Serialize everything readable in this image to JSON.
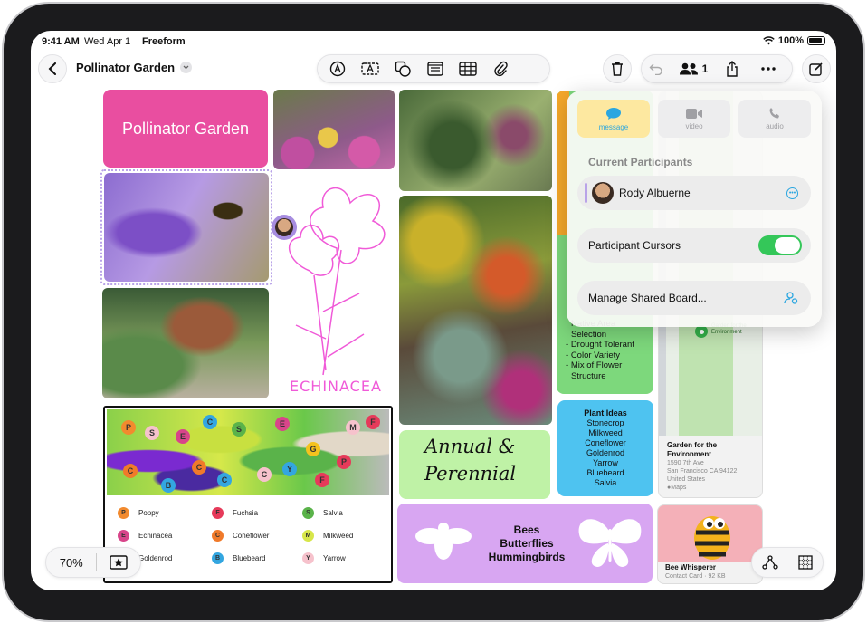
{
  "status_bar": {
    "time": "9:41 AM",
    "date": "Wed Apr 1",
    "app": "Freeform",
    "battery": "100%"
  },
  "header": {
    "board_title": "Pollinator Garden",
    "participant_count": "1"
  },
  "board": {
    "title_card": "Pollinator Garden",
    "sketch_label": "ECHINACEA",
    "handwriting_line1": "Annual &",
    "handwriting_line2": "Perennial",
    "pollinators": [
      "Bees",
      "Butterflies",
      "Hummingbirds"
    ],
    "list_items": [
      "Native Area",
      "Selection",
      "Drought Tolerant",
      "Color Variety",
      "Mix of Flower",
      "Structure"
    ],
    "plant_ideas": {
      "title": "Plant Ideas",
      "items": [
        "Stonecrop",
        "Milkweed",
        "Coneflower",
        "Goldenrod",
        "Yarrow",
        "Bluebeard",
        "Salvia"
      ]
    },
    "map": {
      "pin_label": "Garden for the Environment",
      "name": "Garden for the Environment",
      "address1": "1590 7th Ave",
      "address2": "San Francisco CA 94122",
      "country": "United States",
      "source": "Maps"
    },
    "contact": {
      "name": "Bee Whisperer",
      "meta": "Contact Card · 92 KB"
    },
    "legend": [
      {
        "letter": "P",
        "name": "Poppy",
        "color": "#f28a2e"
      },
      {
        "letter": "F",
        "name": "Fuchsia",
        "color": "#e63a5a"
      },
      {
        "letter": "S",
        "name": "Salvia",
        "color": "#5ab34a"
      },
      {
        "letter": "E",
        "name": "Echinacea",
        "color": "#d8458a"
      },
      {
        "letter": "C",
        "name": "Coneflower",
        "color": "#f07a2a"
      },
      {
        "letter": "M",
        "name": "Milkweed",
        "color": "#d7e64a"
      },
      {
        "letter": "G",
        "name": "Goldenrod",
        "color": "#f4c21e"
      },
      {
        "letter": "B",
        "name": "Bluebeard",
        "color": "#33a6e0"
      },
      {
        "letter": "Y",
        "name": "Yarrow",
        "color": "#f6c2cc"
      }
    ]
  },
  "popover": {
    "options": [
      "message",
      "video",
      "audio"
    ],
    "section_title": "Current Participants",
    "participant": "Rody Albuerne",
    "cursors_label": "Participant Cursors",
    "manage_label": "Manage Shared Board..."
  },
  "bottom": {
    "zoom": "70%"
  },
  "colors": {
    "accent": "#2aa6e0",
    "toggle_on": "#34c759",
    "title_card": "#e94ea0",
    "list_card": "#7dd87c",
    "ideas_card": "#4ec3f0",
    "pollinator_card": "#d8a6f2"
  }
}
